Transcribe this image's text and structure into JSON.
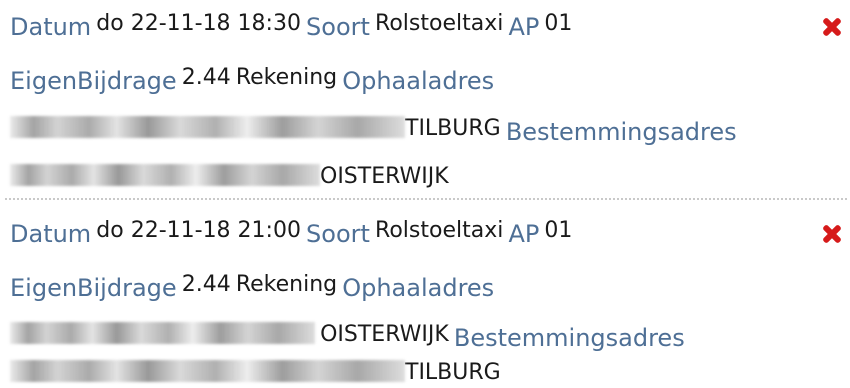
{
  "records": [
    {
      "datum_label": "Datum",
      "datum_value": "do 22-11-18 18:30",
      "soort_label": "Soort",
      "soort_value": "Rolstoeltaxi",
      "ap_label": "AP",
      "ap_value": "01",
      "eigenbijdrage_label": "EigenBijdrage",
      "eigenbijdrage_value": "2.44",
      "rekening_value": "Rekening",
      "ophaal_label": "Ophaaladres",
      "ophaal_city": "TILBURG",
      "bestemming_label": "Bestemmingsadres",
      "bestemming_city": "OISTERWIJK",
      "delete_icon": "red-x-icon"
    },
    {
      "datum_label": "Datum",
      "datum_value": "do 22-11-18 21:00",
      "soort_label": "Soort",
      "soort_value": "Rolstoeltaxi",
      "ap_label": "AP",
      "ap_value": "01",
      "eigenbijdrage_label": "EigenBijdrage",
      "eigenbijdrage_value": "2.44",
      "rekening_value": "Rekening",
      "ophaal_label": "Ophaaladres",
      "ophaal_city": "OISTERWIJK",
      "bestemming_label": "Bestemmingsadres",
      "bestemming_city": "TILBURG",
      "delete_icon": "red-x-icon"
    }
  ],
  "colors": {
    "label": "#4e6f95",
    "value": "#1a1a1a",
    "delete": "#d61a1a",
    "separator": "#c9c9c9"
  }
}
